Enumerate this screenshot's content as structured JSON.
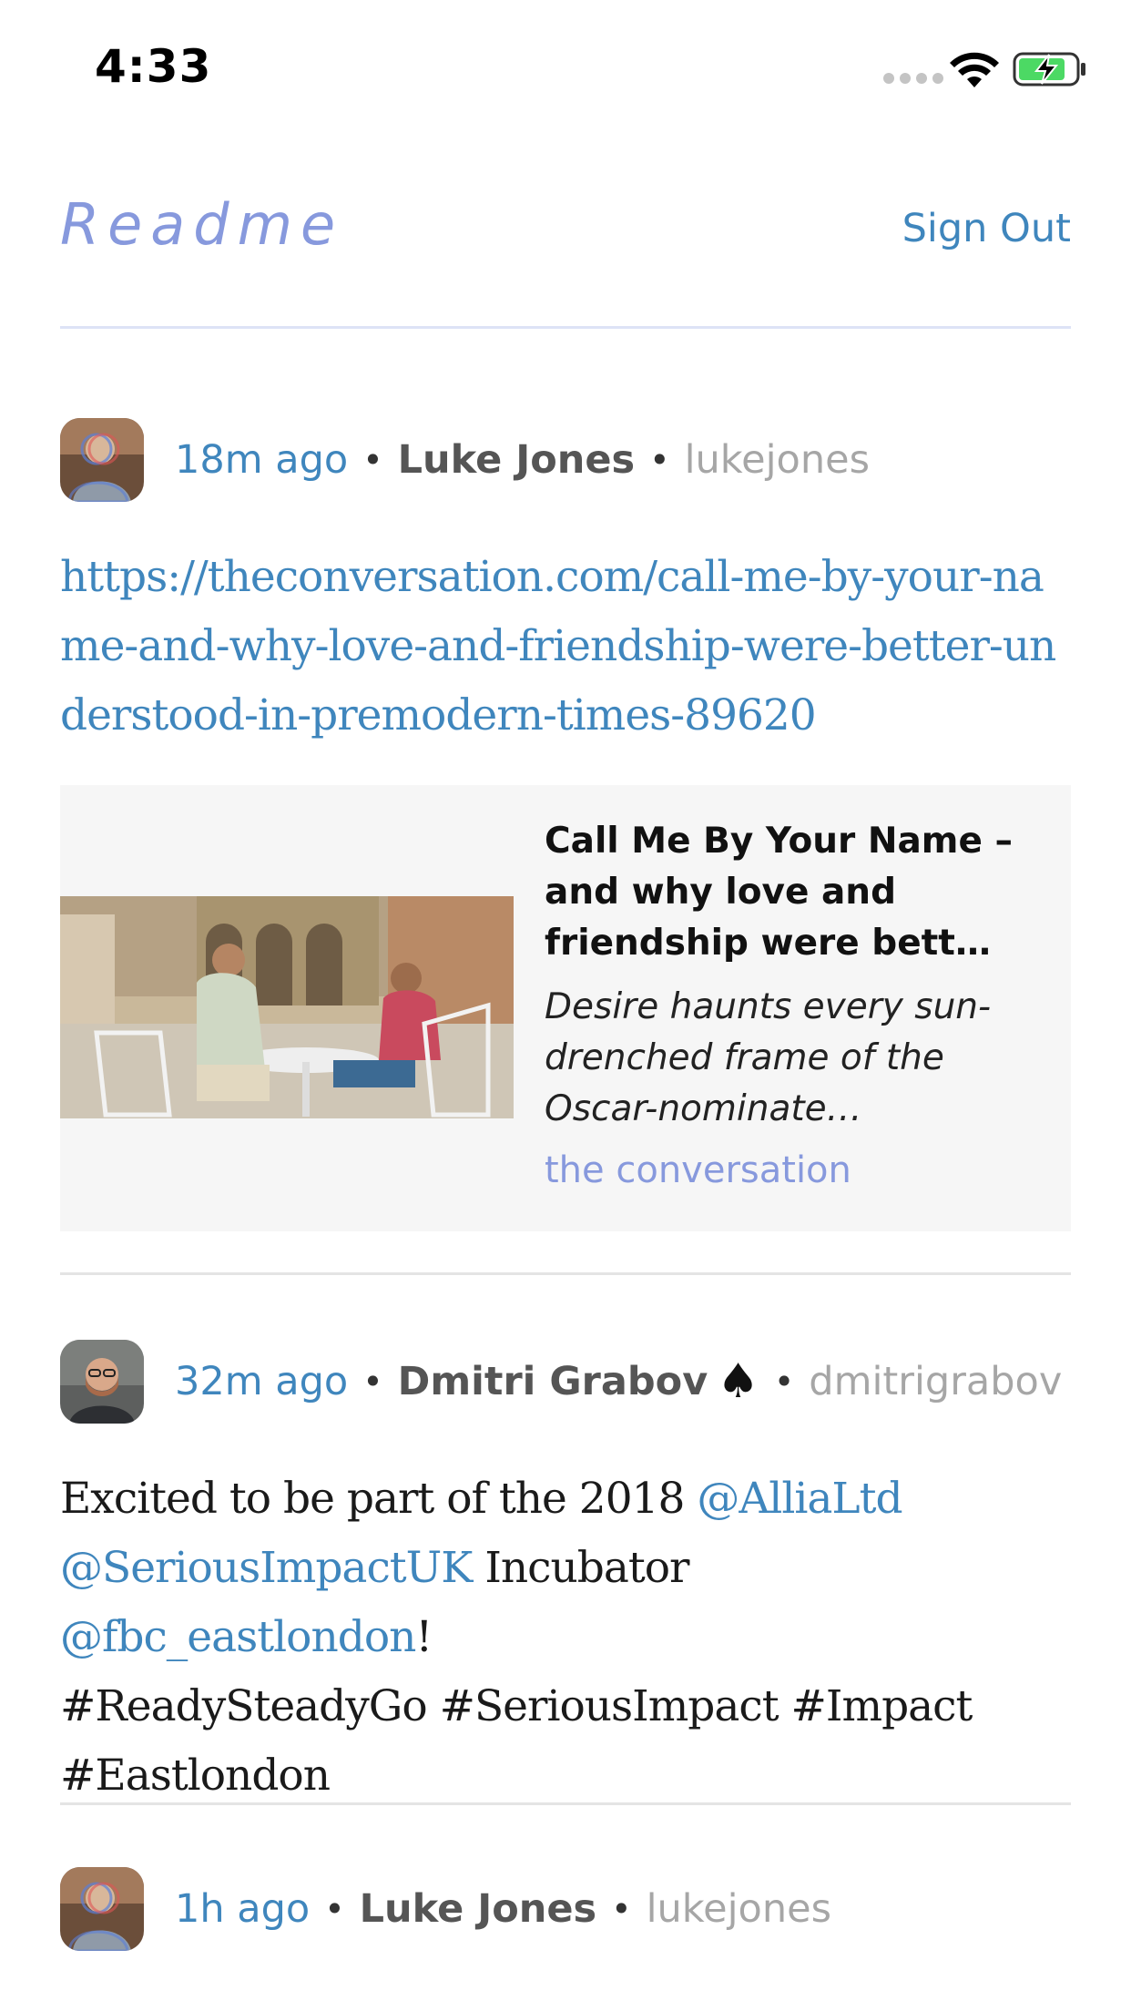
{
  "status_bar": {
    "time": "4:33",
    "signal_icon": "signal-dots-icon",
    "wifi_icon": "wifi-icon",
    "battery_icon": "battery-charging-icon"
  },
  "header": {
    "title": "Readme",
    "sign_out": "Sign Out",
    "title_color": "#8799dd",
    "link_color": "#3f86bd"
  },
  "posts": [
    {
      "time": "18m ago",
      "name": "Luke Jones",
      "handle": "lukejones",
      "body_link": "https://theconversation.com/call-me-by-your-name-and-why-love-and-friendship-were-better-understood-in-premodern-times-89620",
      "preview": {
        "title": "Call Me By Your Name – and why love and friendship were bett…",
        "description": "Desire haunts every sun-drenched frame of the Oscar-nominate…",
        "source": "the conversation"
      }
    },
    {
      "time": "32m ago",
      "name": "Dmitri Grabov",
      "name_emoji": "♠",
      "handle": "dmitrigrabov",
      "body": {
        "t1": "Excited to be part of the 2018 ",
        "m1": "@AlliaLtd",
        "m2": "@SeriousImpactUK",
        "t2": " Incubator ",
        "m3": "@fbc_eastlondon",
        "t3": "!",
        "t4": "#ReadySteadyGo #SeriousImpact #Impact",
        "t5": "#Eastlondon"
      }
    },
    {
      "time": "1h ago",
      "name": "Luke Jones",
      "handle": "lukejones"
    }
  ]
}
